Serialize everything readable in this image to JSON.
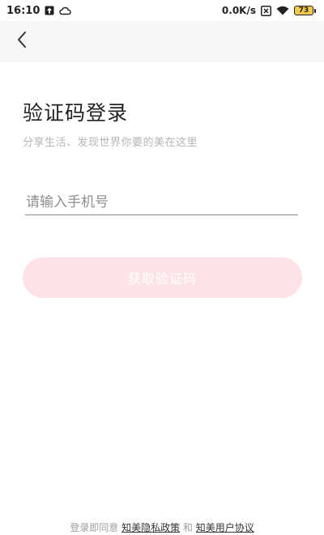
{
  "status_bar": {
    "time": "16:10",
    "net_speed": "0.0K/s",
    "battery_level": "73",
    "icons": [
      "upload-icon",
      "cloud-icon",
      "sim-x-icon",
      "wifi-icon",
      "battery-icon"
    ]
  },
  "nav": {
    "back_icon": "chevron-left-icon"
  },
  "login": {
    "title": "验证码登录",
    "subtitle": "分享生活、发现世界你要的美在这里",
    "phone_placeholder": "请输入手机号",
    "phone_value": "",
    "get_code_label": "获取验证码",
    "button_color": "#fde3e8"
  },
  "footer": {
    "prefix": "登录即同意",
    "privacy_link": "知美隐私政策",
    "conjunction": "和",
    "agreement_link": "知美用户协议"
  }
}
